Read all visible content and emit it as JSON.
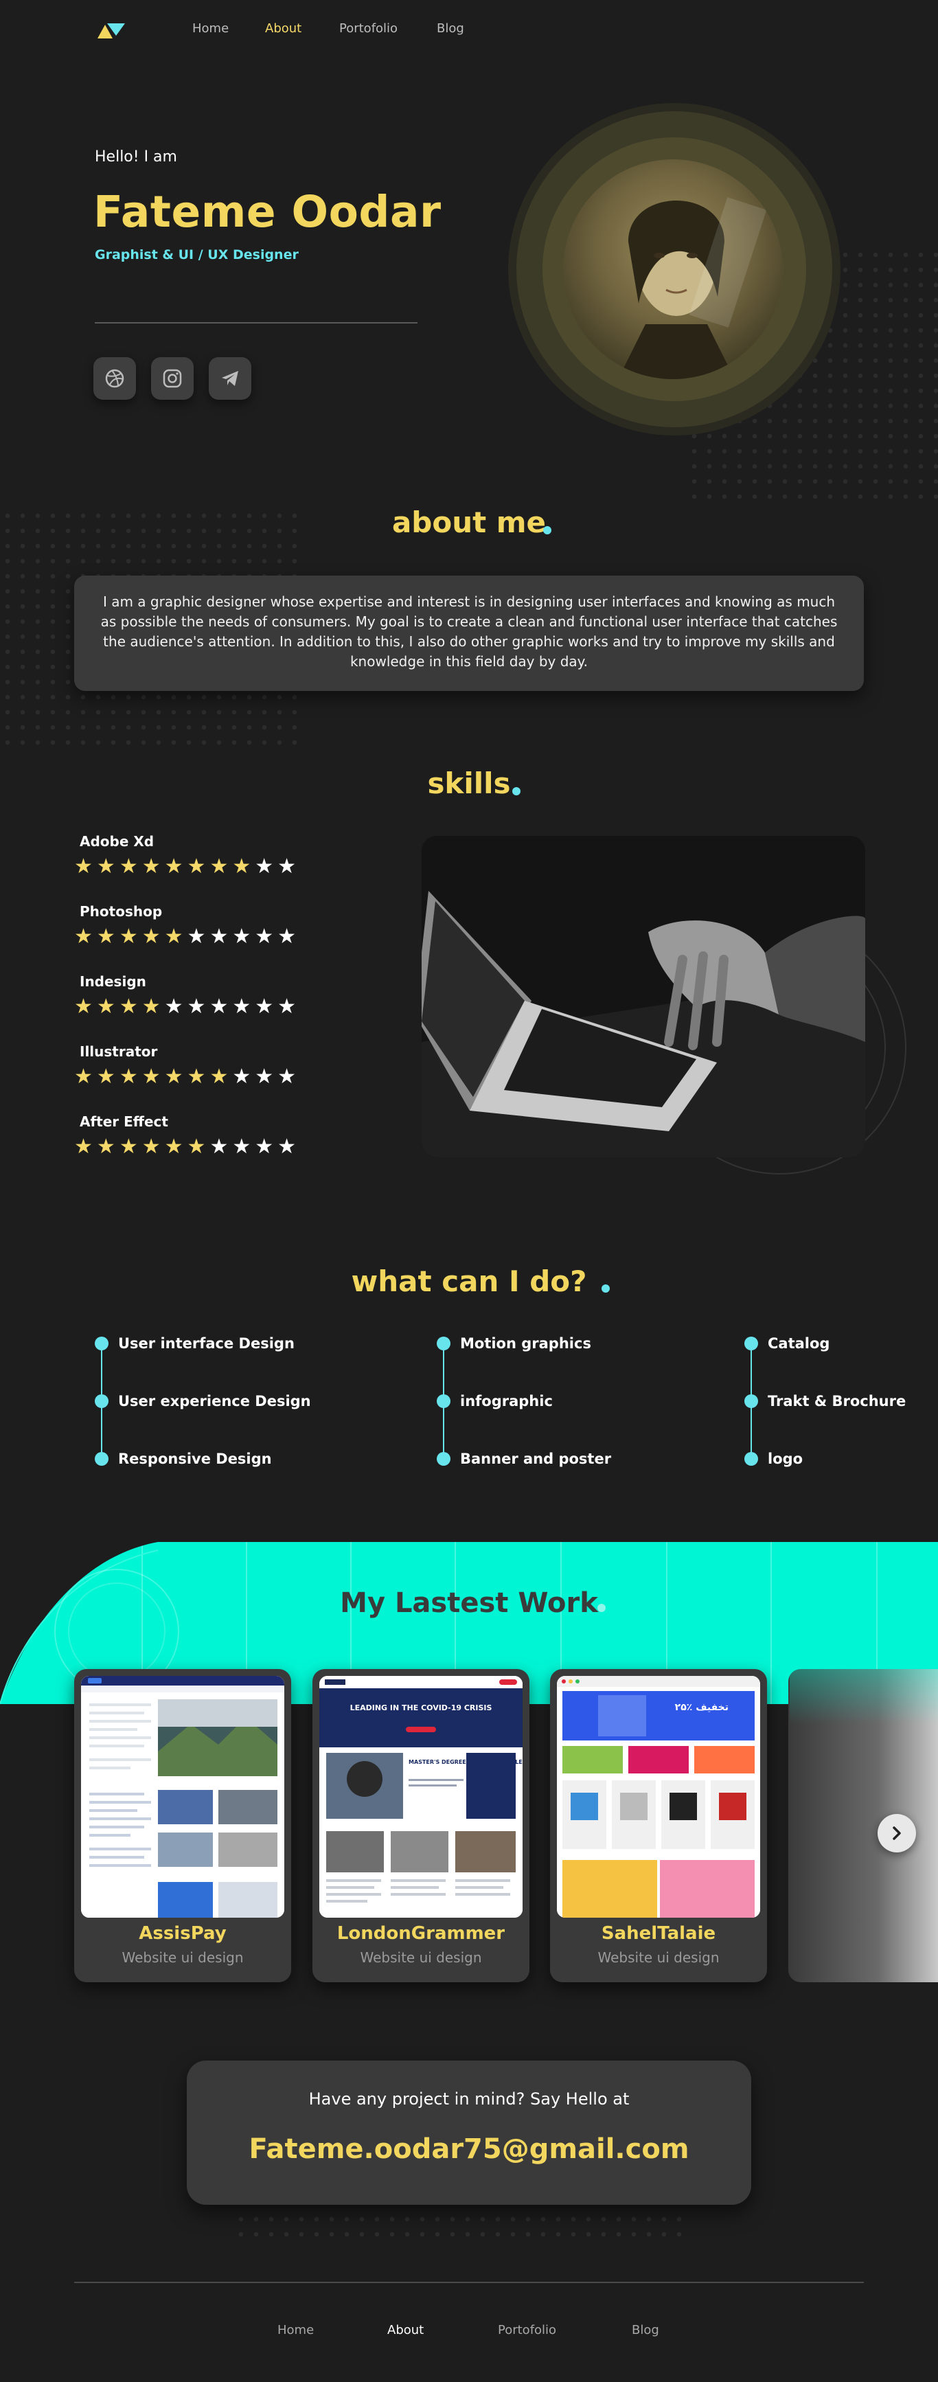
{
  "nav": {
    "items": [
      "Home",
      "About",
      "Portofolio",
      "Blog"
    ],
    "active": "About"
  },
  "hero": {
    "greeting": "Hello!  I am",
    "name": "Fateme Oodar",
    "role": "Graphist & UI / UX Designer",
    "social": [
      "dribbble-icon",
      "instagram-icon",
      "telegram-icon"
    ]
  },
  "about": {
    "title": "about me",
    "text": "I am a graphic designer whose expertise and interest is in designing user interfaces and knowing as much as possible the needs of consumers. My goal is to create a clean and functional user interface that catches the audience's attention. In addition to this, I also do other graphic works and try to improve my skills and knowledge in this field day by day."
  },
  "skills": {
    "title": "skills",
    "max_stars": 10,
    "items": [
      {
        "name": "Adobe Xd",
        "rating": 8
      },
      {
        "name": "Photoshop",
        "rating": 5
      },
      {
        "name": "Indesign",
        "rating": 4
      },
      {
        "name": "Illustrator",
        "rating": 7
      },
      {
        "name": "After Effect",
        "rating": 6
      }
    ]
  },
  "services": {
    "title": "what can I do?",
    "columns": [
      [
        "User interface Design",
        "User experience Design",
        "Responsive Design"
      ],
      [
        "Motion graphics",
        "infographic",
        "Banner and poster"
      ],
      [
        "Catalog",
        "Trakt & Brochure",
        "logo"
      ]
    ]
  },
  "work": {
    "title": "My Lastest Work",
    "cards": [
      {
        "title": "AssisPay",
        "subtitle": "Website ui design"
      },
      {
        "title": "LondonGrammer",
        "subtitle": "Website ui design"
      },
      {
        "title": "SahelTalaie",
        "subtitle": "Website ui design"
      }
    ],
    "preview_text": {
      "london_headline": "LEADING IN THE COVID-19 CRISIS",
      "london_box": "MASTER'S DEGREE FOR BUSINESS LEADERS",
      "sahel_banner": "۲۵٪ تخفیف"
    }
  },
  "contact": {
    "question": "Have any project in mind? Say Hello at",
    "email": "Fateme.oodar75@gmail.com"
  },
  "footer": {
    "items": [
      "Home",
      "About",
      "Portofolio",
      "Blog"
    ],
    "active": "About"
  },
  "colors": {
    "accent_yellow": "#f2d65e",
    "accent_cyan": "#67e4ec",
    "band": "#00f5d4",
    "bg": "#1d1d1d"
  }
}
